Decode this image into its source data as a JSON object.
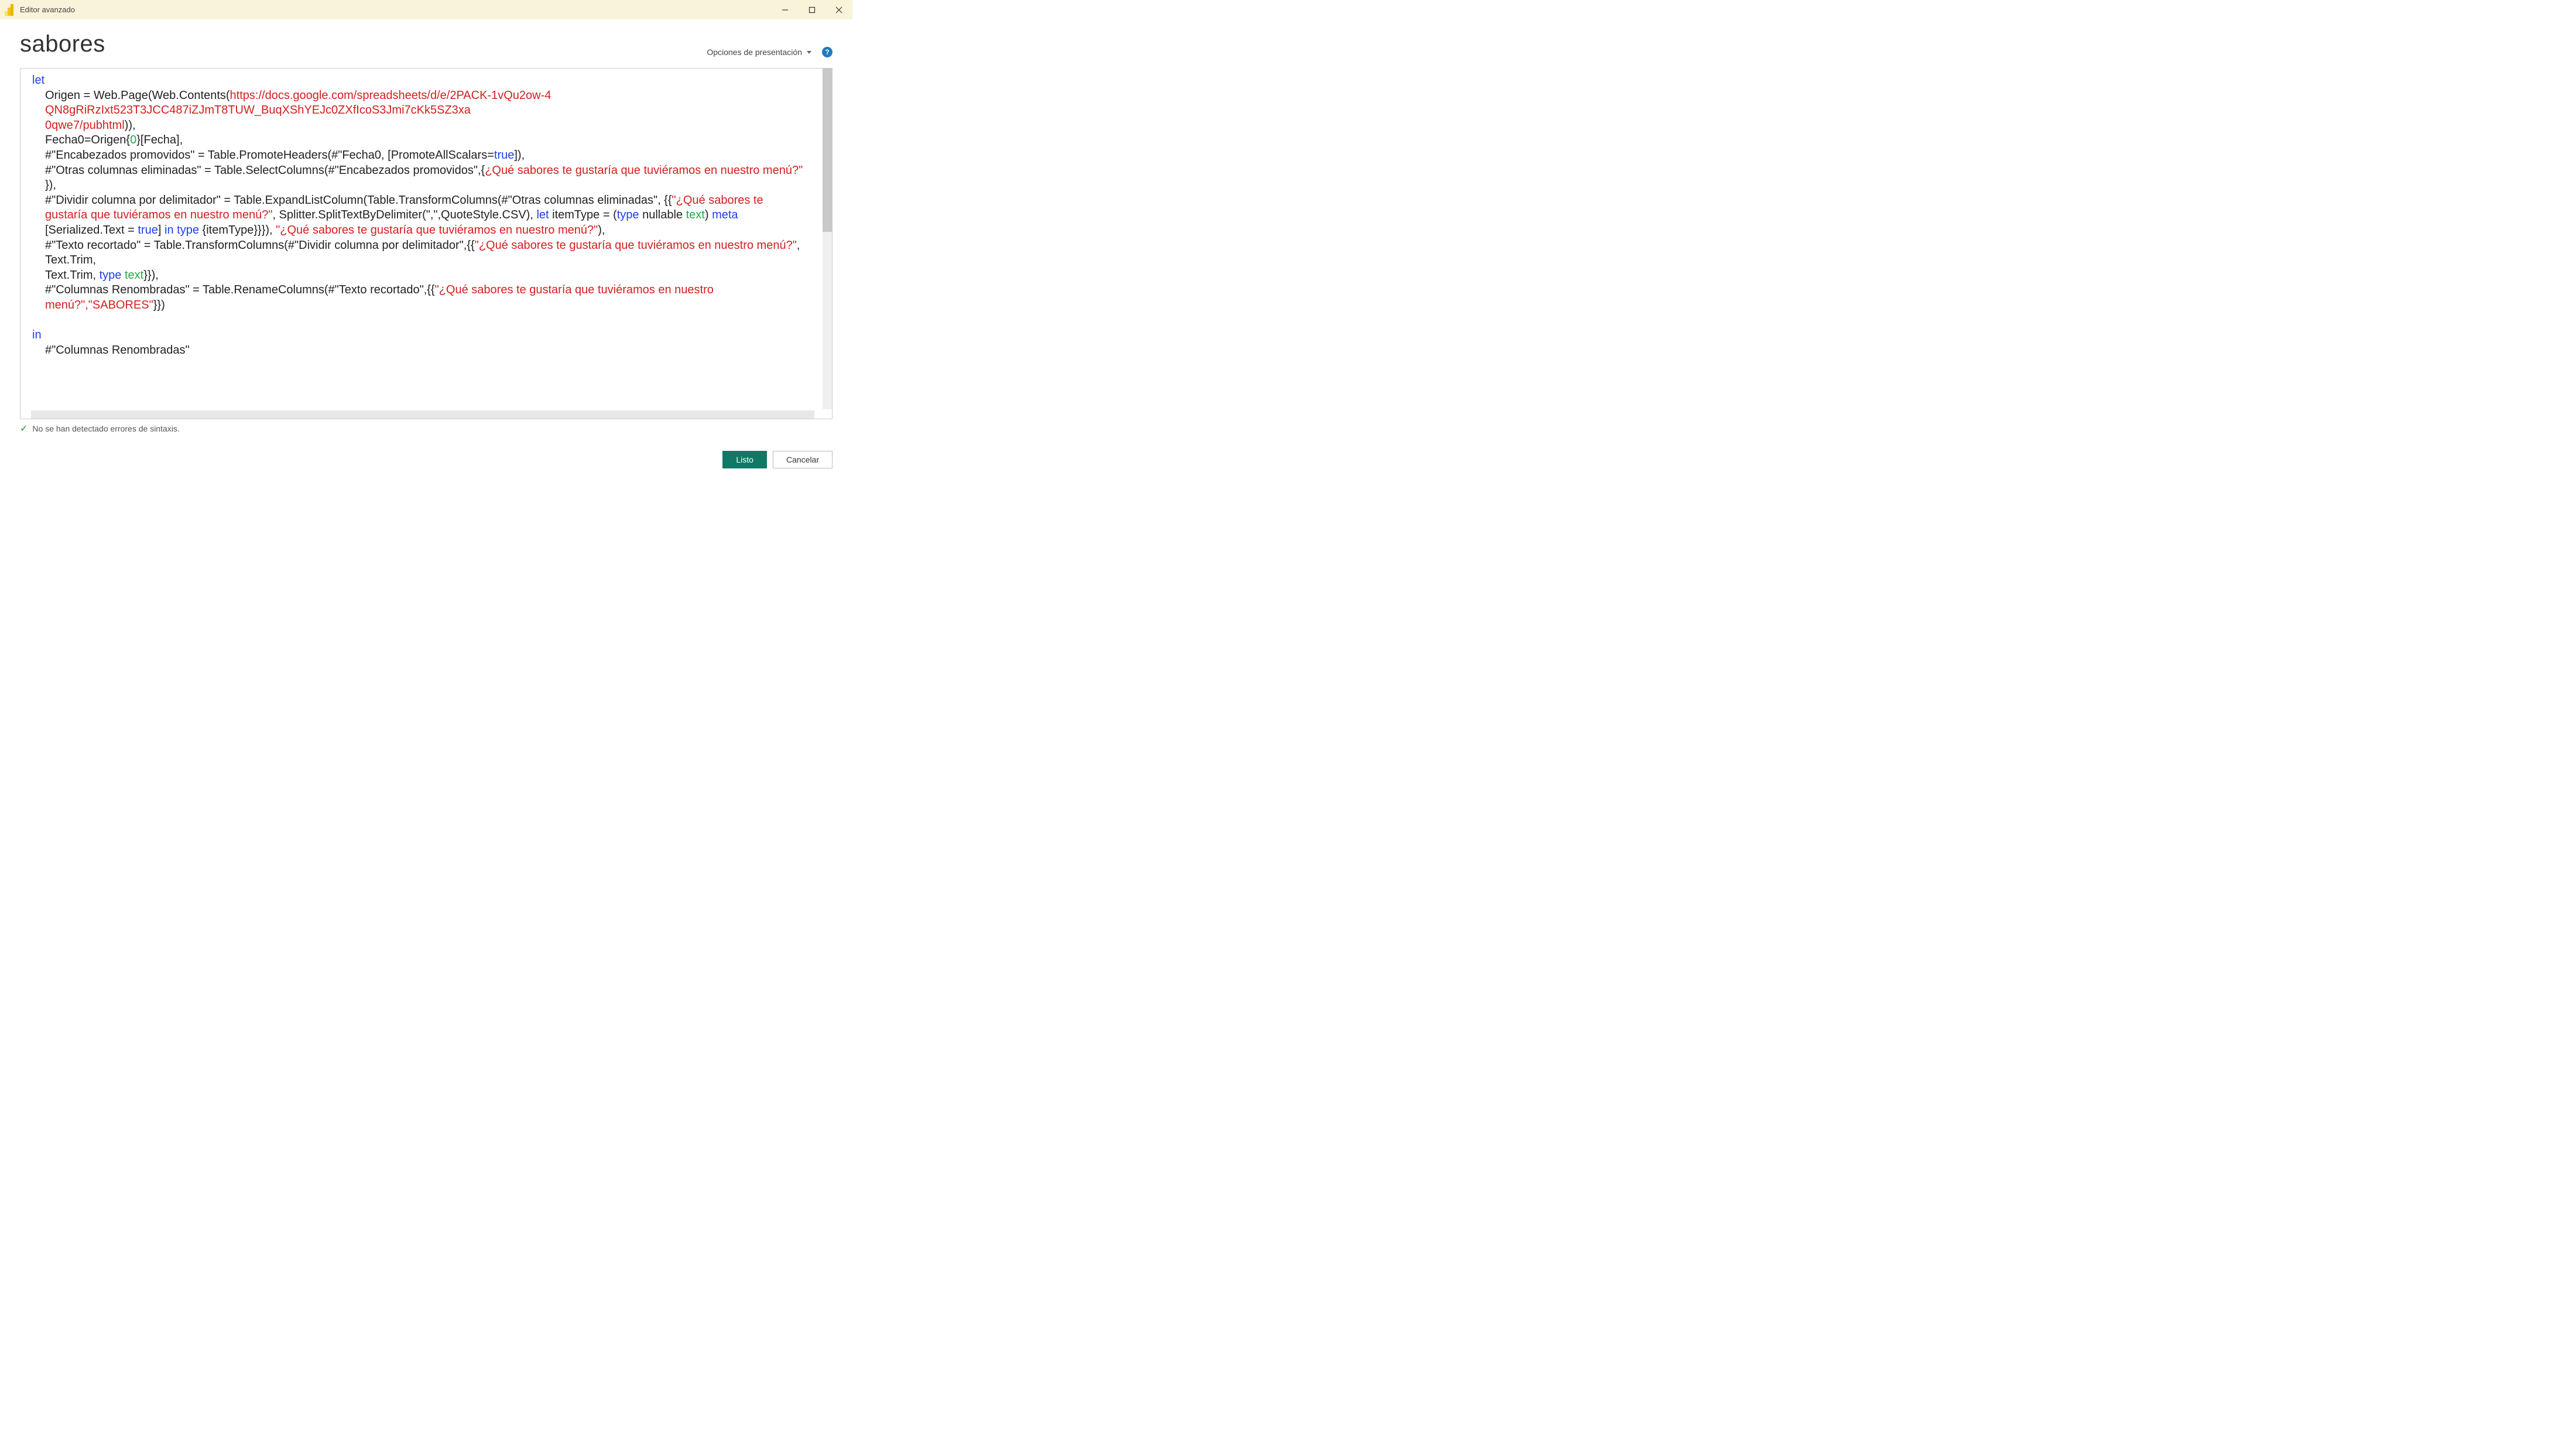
{
  "titlebar": {
    "title": "Editor avanzado"
  },
  "header": {
    "query_title": "sabores",
    "display_options_label": "Opciones de presentación"
  },
  "code": {
    "let_kw": "let",
    "line_origen_prefix": "Origen = Web.Page(Web.Contents(",
    "url_part1": "https://docs.google.com/spreadsheets/d/e/2PACK-1vQu2ow-4",
    "url_part2": "QN8gRiRzIxt523T3JCC487iZJmT8TUW_BuqXShYEJc0ZXfIcoS3Jmi7cKk5SZ3xa",
    "url_part3": "0qwe7/pubhtml",
    "url_close": ")),",
    "fecha_prefix": "Fecha0=Origen{",
    "fecha_zero": "0",
    "fecha_suffix": "}[Fecha],",
    "encab_prefix": "#\"Encabezados promovidos\" = Table.PromoteHeaders(#\"Fecha0, [PromoteAllScalars=",
    "true_kw": "true",
    "encab_suffix": "]),",
    "otras_prefix": "#\"Otras columnas eliminadas\" = Table.SelectColumns(#\"Encabezados promovidos\",{",
    "sabores_q1": "¿Qué sabores te gustaría que tuviéramos en nuestro menú?\"",
    "otras_suffix": "}),",
    "dividir_prefix": "#\"Dividir columna por delimitador\" = Table.ExpandListColumn(Table.TransformColumns(#\"Otras columnas eliminadas\", {{",
    "sabores_q2_a": "\"¿Qué sabores te",
    "sabores_q2_b": "gustaría que tuviéramos en nuestro menú?\"",
    "splitter_text": ", Splitter.SplitTextByDelimiter(\",\",QuoteStyle.CSV), ",
    "let_inline": "let",
    "itemtype_prefix": " itemType = (",
    "type_kw": "type",
    "nullable_text": " nullable ",
    "text_kw": "text",
    "meta_text": ") ",
    "meta_kw": "meta",
    "serialized_prefix": "[Serialized.Text = ",
    "serialized_suffix": "] ",
    "in_inline": "in",
    "in_type_prefix": " ",
    "itemtype_close": " {itemType}}}), ",
    "sabores_q3": "\"¿Qué sabores te gustaría que tuviéramos en nuestro menú?\"",
    "dividir_close": "),",
    "texto_prefix": "#\"Texto recortado\" = Table.TransformColumns(#\"Dividir columna por delimitador\",{{",
    "sabores_q4": "\"¿Qué sabores te gustaría que tuviéramos en nuestro menú?\"",
    "texto_trim": ", Text.Trim, ",
    "texto_close": "}}),",
    "renamed_prefix": "#\"Columnas Renombradas\" = Table.RenameColumns(#\"Texto recortado\",{{",
    "sabores_q5a": "\"¿Qué sabores te gustaría que tuviéramos en nuestro",
    "sabores_q5b": "menú?\",\"SABORES\"",
    "renamed_close": "}})",
    "in_kw": "in",
    "final_line": "#\"Columnas Renombradas\""
  },
  "status": {
    "message": "No se han detectado errores de sintaxis."
  },
  "buttons": {
    "done": "Listo",
    "cancel": "Cancelar"
  }
}
